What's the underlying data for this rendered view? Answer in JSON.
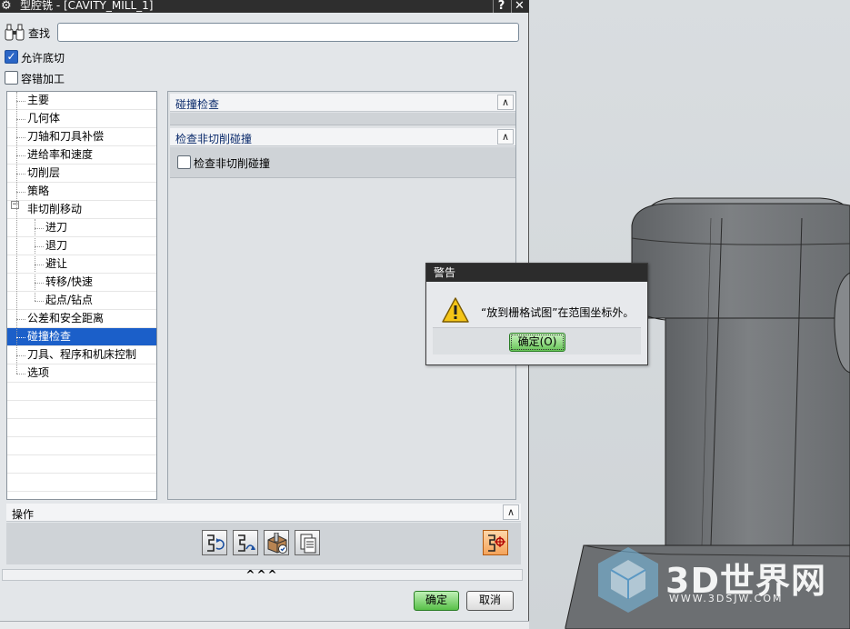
{
  "dialog": {
    "title": "型腔铣 - [CAVITY_MILL_1]",
    "help_label": "?",
    "close_label": "✕",
    "find_label": "查找",
    "find_value": "",
    "allow_undercut_label": "允许底切",
    "allow_undercut_checked": true,
    "fault_tolerant_label": "容错加工",
    "fault_tolerant_checked": false
  },
  "tree": {
    "items": [
      {
        "label": "主要",
        "level": 0
      },
      {
        "label": "几何体",
        "level": 0
      },
      {
        "label": "刀轴和刀具补偿",
        "level": 0
      },
      {
        "label": "进给率和速度",
        "level": 0
      },
      {
        "label": "切削层",
        "level": 0
      },
      {
        "label": "策略",
        "level": 0
      },
      {
        "label": "非切削移动",
        "level": 0,
        "expanded": true
      },
      {
        "label": "进刀",
        "level": 1
      },
      {
        "label": "退刀",
        "level": 1
      },
      {
        "label": "避让",
        "level": 1
      },
      {
        "label": "转移/快速",
        "level": 1
      },
      {
        "label": "起点/钻点",
        "level": 1
      },
      {
        "label": "公差和安全距离",
        "level": 0
      },
      {
        "label": "碰撞检查",
        "level": 0,
        "selected": true
      },
      {
        "label": "刀具、程序和机床控制",
        "level": 0
      },
      {
        "label": "选项",
        "level": 0
      }
    ],
    "toggle_symbol": "−"
  },
  "panel": {
    "group1_title": "碰撞检查",
    "group2_title": "检查非切削碰撞",
    "check_noncut_label": "检查非切削碰撞",
    "check_noncut_checked": false,
    "collapse_symbol": "∧"
  },
  "operations": {
    "title": "操作",
    "collapse_symbol": "∧",
    "expand_symbol": "^^^",
    "buttons": [
      "generate-icon",
      "replay-icon",
      "verify-icon",
      "list-icon",
      "display-icon"
    ]
  },
  "footer": {
    "ok_label": "确定",
    "cancel_label": "取消"
  },
  "warning": {
    "title": "警告",
    "message": "“放到栅格试图”在范围坐标外。",
    "ok_label": "确定(O)"
  },
  "watermark": {
    "text": "3D世界网",
    "url": "WWW.3DSJW.COM"
  },
  "colors": {
    "selection": "#1b5fc9",
    "ok_green": "#58c048",
    "titlebar": "#2e2e2e",
    "highlight_orange": "#f4a35a"
  }
}
